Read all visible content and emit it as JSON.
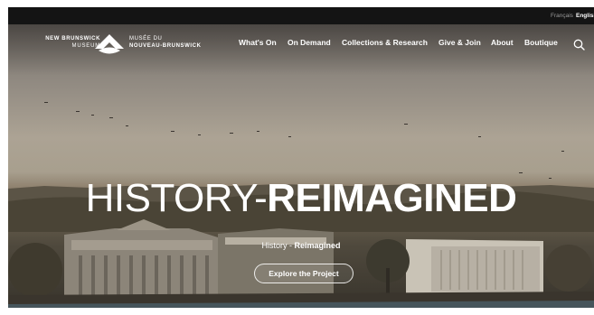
{
  "language": {
    "french": "Français",
    "english": "English"
  },
  "logo": {
    "en_line1": "NEW BRUNSWICK",
    "en_line2": "MUSEUM",
    "fr_line1": "MUSÉE DU",
    "fr_line2": "NOUVEAU-BRUNSWICK",
    "mark_icon": "museum-logo-mark-icon"
  },
  "nav": {
    "items": [
      {
        "label": "What's On"
      },
      {
        "label": "On Demand"
      },
      {
        "label": "Collections & Research"
      },
      {
        "label": "Give & Join"
      },
      {
        "label": "About"
      },
      {
        "label": "Boutique"
      }
    ],
    "search_icon": "search-icon"
  },
  "hero": {
    "headline_part1": "HISTORY-",
    "headline_part2": "REIMAGINED",
    "subtitle_part1": "History - ",
    "subtitle_part2": "Reimagined",
    "cta_label": "Explore the Project"
  },
  "colors": {
    "topbar": "#141414",
    "text": "#ffffff"
  }
}
